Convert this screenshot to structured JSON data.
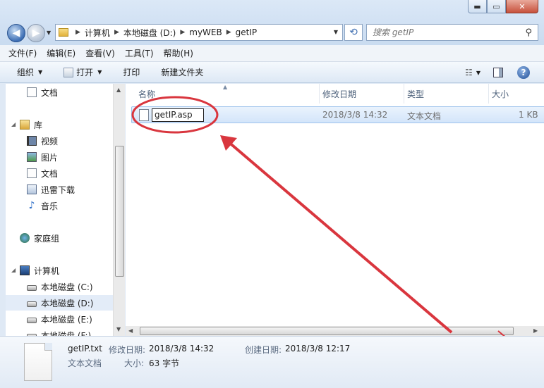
{
  "address": {
    "segments": [
      "计算机",
      "本地磁盘 (D:)",
      "myWEB",
      "getIP"
    ]
  },
  "search": {
    "placeholder": "搜索 getIP"
  },
  "menu": [
    "文件(F)",
    "编辑(E)",
    "查看(V)",
    "工具(T)",
    "帮助(H)"
  ],
  "toolbar": {
    "organize": "组织",
    "open": "打开",
    "print": "打印",
    "new_folder": "新建文件夹"
  },
  "sidebar": {
    "items": [
      {
        "label": "文档",
        "icon": "document-icon"
      },
      {
        "label": "库",
        "icon": "library-icon"
      },
      {
        "label": "视频",
        "icon": "video-icon"
      },
      {
        "label": "图片",
        "icon": "picture-icon"
      },
      {
        "label": "文档",
        "icon": "document-icon"
      },
      {
        "label": "迅雷下载",
        "icon": "download-icon"
      },
      {
        "label": "音乐",
        "icon": "music-icon"
      },
      {
        "label": "家庭组",
        "icon": "homegroup-icon"
      },
      {
        "label": "计算机",
        "icon": "computer-icon"
      },
      {
        "label": "本地磁盘 (C:)",
        "icon": "drive-icon"
      },
      {
        "label": "本地磁盘 (D:)",
        "icon": "drive-icon"
      },
      {
        "label": "本地磁盘 (E:)",
        "icon": "drive-icon"
      },
      {
        "label": "本地磁盘 (F:)",
        "icon": "drive-icon"
      }
    ]
  },
  "columns": {
    "name": "名称",
    "modified": "修改日期",
    "type": "类型",
    "size": "大小"
  },
  "files": [
    {
      "name": "getIP.asp",
      "modified": "2018/3/8 14:32",
      "type": "文本文档",
      "size": "1 KB"
    }
  ],
  "details": {
    "name": "getIP.txt",
    "kind": "文本文档",
    "modified_label": "修改日期:",
    "modified": "2018/3/8 14:32",
    "created_label": "创建日期:",
    "created": "2018/3/8 12:17",
    "size_label": "大小:",
    "size": "63 字节"
  },
  "colors": {
    "annotation": "#d9363e",
    "selection": "#d3e5fa"
  }
}
